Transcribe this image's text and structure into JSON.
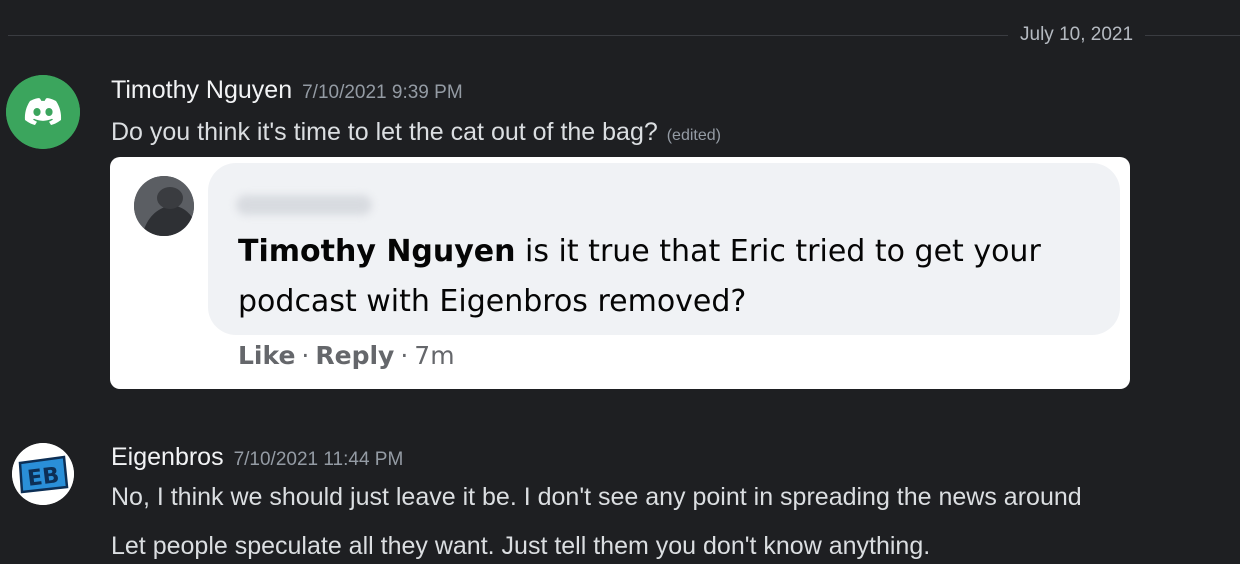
{
  "divider": {
    "date": "July 10, 2021"
  },
  "messages": [
    {
      "username": "Timothy Nguyen",
      "timestamp": "7/10/2021 9:39 PM",
      "text": "Do you think it's time to let the cat out of the bag?",
      "edited": "(edited)",
      "avatar_icon": "discord-icon",
      "avatar_color": "#3ba55d",
      "embed": {
        "comment_name": "Timothy Nguyen",
        "comment_text": " is it true that Eric tried to get your podcast with Eigenbros removed?",
        "actions": {
          "like": "Like",
          "reply": "Reply",
          "separator": "·",
          "time": "7m"
        }
      }
    },
    {
      "username": "Eigenbros",
      "timestamp": "7/10/2021 11:44 PM",
      "avatar_text": "EB",
      "lines": [
        "No, I think we should just leave it be. I don't see any point in spreading the news around",
        "Let people speculate all they want. Just tell them you don't know anything."
      ]
    }
  ]
}
